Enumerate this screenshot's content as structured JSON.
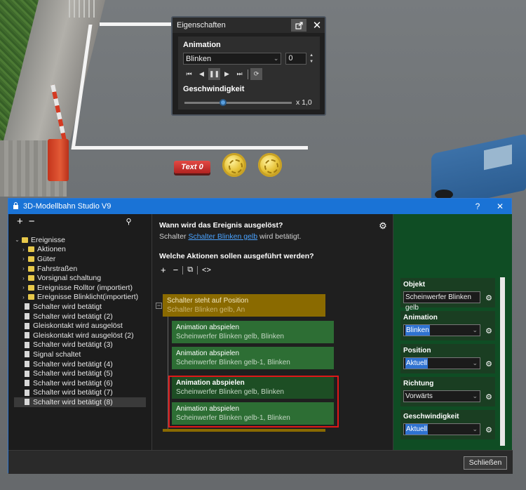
{
  "scene": {
    "sign_text": "Text 0"
  },
  "props_window": {
    "title": "Eigenschaften",
    "animation_label": "Animation",
    "animation_value": "Blinken",
    "frame_value": "0",
    "speed_label": "Geschwindigkeit",
    "speed_value": "x 1,0",
    "speed_level": 0.35
  },
  "studio": {
    "title": "3D-Modellbahn Studio V9",
    "help": "?",
    "close": "✕",
    "tree": {
      "root": "Ereignisse",
      "folders": [
        "Aktionen",
        "Güter",
        "Fahrstraßen",
        "Vorsignal schaltung",
        "Ereignisse Rolltor (importiert)",
        "Ereignisse Blinklicht(importiert)"
      ],
      "events": [
        "Schalter wird betätigt",
        "Schalter wird betätigt (2)",
        "Gleiskontakt wird ausgelöst",
        "Gleiskontakt wird ausgelöst (2)",
        "Schalter wird betätigt (3)",
        "Signal schaltet",
        "Schalter wird betätigt (4)",
        "Schalter wird betätigt (5)",
        "Schalter wird betätigt (6)",
        "Schalter wird betätigt (7)",
        "Schalter wird betätigt (8)"
      ]
    },
    "event": {
      "question": "Wann wird das Ereignis ausgelöst?",
      "trigger_prefix": "Schalter",
      "trigger_link": "Schalter Blinken gelb",
      "trigger_suffix": "wird betätigt.",
      "actions_question": "Welche Aktionen sollen ausgeführt werden?",
      "condition_title": "Schalter steht auf Position",
      "condition_sub": "Schalter Blinken gelb, An",
      "actions": [
        {
          "title": "Animation abspielen",
          "sub": "Scheinwerfer Blinken gelb, Blinken"
        },
        {
          "title": "Animation abspielen",
          "sub": "Scheinwerfer Blinken gelb-1, Blinken"
        },
        {
          "title": "Animation abspielen",
          "sub": "Scheinwerfer Blinken gelb, Blinken"
        },
        {
          "title": "Animation abspielen",
          "sub": "Scheinwerfer Blinken gelb-1, Blinken"
        }
      ]
    },
    "properties": [
      {
        "label": "Objekt",
        "value": "Scheinwerfer Blinken gelb"
      },
      {
        "label": "Animation",
        "value": "Blinken"
      },
      {
        "label": "Position",
        "value": "Aktuell"
      },
      {
        "label": "Richtung",
        "value": "Vorwärts"
      },
      {
        "label": "Geschwindigkeit",
        "value": "Aktuell"
      }
    ],
    "close_button": "Schließen"
  }
}
